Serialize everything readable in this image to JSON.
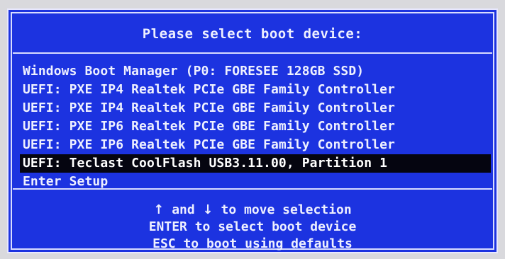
{
  "dialog": {
    "title": "Please select boot device:",
    "items": [
      {
        "label": "Windows Boot Manager (P0: FORESEE 128GB SSD)",
        "selected": false
      },
      {
        "label": "UEFI: PXE IP4 Realtek PCIe GBE Family Controller",
        "selected": false
      },
      {
        "label": "UEFI: PXE IP4 Realtek PCIe GBE Family Controller",
        "selected": false
      },
      {
        "label": "UEFI: PXE IP6 Realtek PCIe GBE Family Controller",
        "selected": false
      },
      {
        "label": "UEFI: PXE IP6 Realtek PCIe GBE Family Controller",
        "selected": false
      },
      {
        "label": "UEFI: Teclast CoolFlash USB3.11.00, Partition 1",
        "selected": true
      },
      {
        "label": "Enter Setup",
        "selected": false
      }
    ],
    "help": {
      "up_arrow": "↑",
      "and_text": " and ",
      "down_arrow": "↓",
      "move_text": " to move selection",
      "enter_line": "ENTER to select boot device",
      "esc_line": "ESC to boot using defaults"
    }
  },
  "colors": {
    "background": "#1c33e0",
    "text": "#eef0ff",
    "highlight": "#050510"
  }
}
